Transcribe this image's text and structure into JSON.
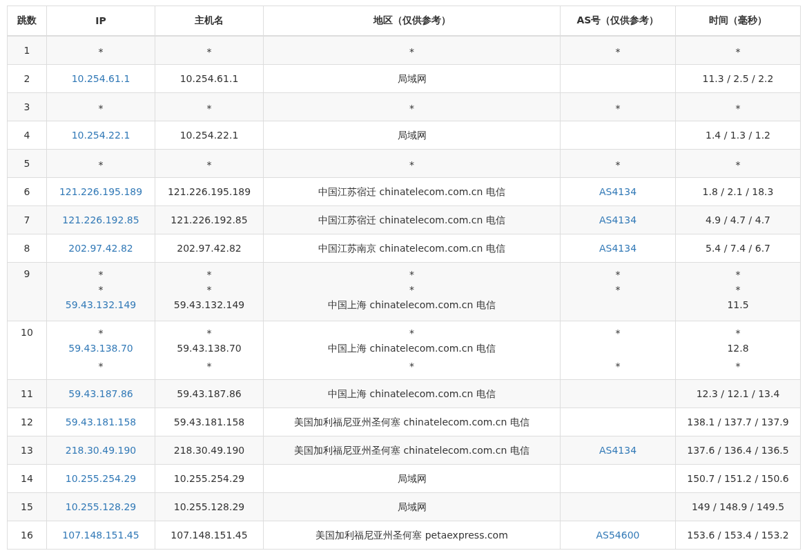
{
  "table": {
    "columns": [
      "跳数",
      "IP",
      "主机名",
      "地区（仅供参考）",
      "AS号（仅供参考）",
      "时间（毫秒）"
    ],
    "rows": [
      {
        "hop": "1",
        "lines": [
          {
            "ip": "*",
            "host": "*",
            "region": "*",
            "as": "*",
            "time": "*"
          }
        ]
      },
      {
        "hop": "2",
        "lines": [
          {
            "ip": "10.254.61.1",
            "host": "10.254.61.1",
            "region": "局域网",
            "time": "11.3 / 2.5 / 2.2"
          }
        ]
      },
      {
        "hop": "3",
        "lines": [
          {
            "ip": "*",
            "host": "*",
            "region": "*",
            "as": "*",
            "time": "*"
          }
        ]
      },
      {
        "hop": "4",
        "lines": [
          {
            "ip": "10.254.22.1",
            "host": "10.254.22.1",
            "region": "局域网",
            "time": "1.4 / 1.3 / 1.2"
          }
        ]
      },
      {
        "hop": "5",
        "lines": [
          {
            "ip": "*",
            "host": "*",
            "region": "*",
            "as": "*",
            "time": "*"
          }
        ]
      },
      {
        "hop": "6",
        "lines": [
          {
            "ip": "121.226.195.189",
            "host": "121.226.195.189",
            "region": "中国江苏宿迁 chinatelecom.com.cn 电信",
            "as": "AS4134",
            "time": "1.8 / 2.1 / 18.3"
          }
        ]
      },
      {
        "hop": "7",
        "lines": [
          {
            "ip": "121.226.192.85",
            "host": "121.226.192.85",
            "region": "中国江苏宿迁 chinatelecom.com.cn 电信",
            "as": "AS4134",
            "time": "4.9 / 4.7 / 4.7"
          }
        ]
      },
      {
        "hop": "8",
        "lines": [
          {
            "ip": "202.97.42.82",
            "host": "202.97.42.82",
            "region": "中国江苏南京 chinatelecom.com.cn 电信",
            "as": "AS4134",
            "time": "5.4 / 7.4 / 6.7"
          }
        ]
      },
      {
        "hop": "9",
        "lines": [
          {
            "ip": "*",
            "host": "*",
            "region": "*",
            "as": "*",
            "time": "*"
          },
          {
            "ip": "*",
            "host": "*",
            "region": "*",
            "as": "*",
            "time": "*"
          },
          {
            "ip": "59.43.132.149",
            "host": "59.43.132.149",
            "region": "中国上海 chinatelecom.com.cn 电信",
            "time": "11.5"
          }
        ]
      },
      {
        "hop": "10",
        "lines": [
          {
            "ip": "*",
            "host": "*",
            "region": "*",
            "as": "*",
            "time": "*"
          },
          {
            "ip": "59.43.138.70",
            "host": "59.43.138.70",
            "region": "中国上海 chinatelecom.com.cn 电信",
            "time": "12.8"
          },
          {
            "ip": "*",
            "host": "*",
            "region": "*",
            "as": "*",
            "time": "*"
          }
        ]
      },
      {
        "hop": "11",
        "lines": [
          {
            "ip": "59.43.187.86",
            "host": "59.43.187.86",
            "region": "中国上海 chinatelecom.com.cn 电信",
            "time": "12.3 / 12.1 / 13.4"
          }
        ]
      },
      {
        "hop": "12",
        "lines": [
          {
            "ip": "59.43.181.158",
            "host": "59.43.181.158",
            "region": "美国加利福尼亚州圣何塞 chinatelecom.com.cn 电信",
            "time": "138.1 / 137.7 / 137.9"
          }
        ]
      },
      {
        "hop": "13",
        "lines": [
          {
            "ip": "218.30.49.190",
            "host": "218.30.49.190",
            "region": "美国加利福尼亚州圣何塞 chinatelecom.com.cn 电信",
            "as": "AS4134",
            "time": "137.6 / 136.4 / 136.5"
          }
        ]
      },
      {
        "hop": "14",
        "lines": [
          {
            "ip": "10.255.254.29",
            "host": "10.255.254.29",
            "region": "局域网",
            "time": "150.7 / 151.2 / 150.6"
          }
        ]
      },
      {
        "hop": "15",
        "lines": [
          {
            "ip": "10.255.128.29",
            "host": "10.255.128.29",
            "region": "局域网",
            "time": "149 / 148.9 / 149.5"
          }
        ]
      },
      {
        "hop": "16",
        "lines": [
          {
            "ip": "107.148.151.45",
            "host": "107.148.151.45",
            "region": "美国加利福尼亚州圣何塞 petaexpress.com",
            "as": "AS54600",
            "time": "153.6 / 153.4 / 153.2"
          }
        ]
      }
    ]
  }
}
